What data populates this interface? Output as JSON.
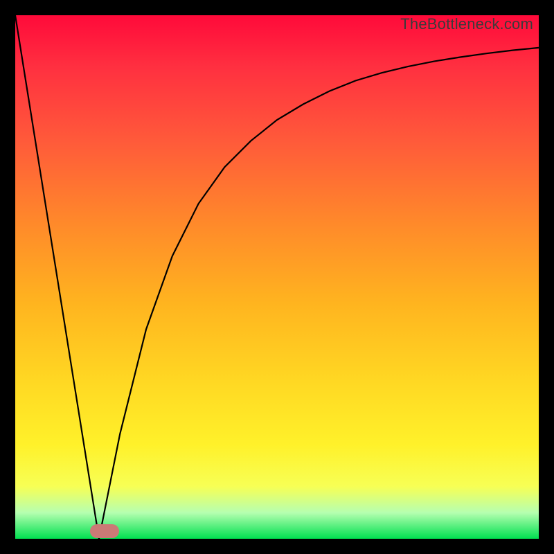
{
  "watermark": {
    "text": "TheBottleneck.com"
  },
  "colors": {
    "frame": "#000000",
    "curve": "#000000",
    "marker": "#cb7a76",
    "gradient_top": "#ff0a3a",
    "gradient_bottom": "#00e050"
  },
  "chart_data": {
    "type": "line",
    "title": "",
    "xlabel": "",
    "ylabel": "",
    "xlim": [
      0,
      100
    ],
    "ylim": [
      0,
      100
    ],
    "series": [
      {
        "name": "left-line",
        "x": [
          0,
          16
        ],
        "values": [
          100,
          0
        ]
      },
      {
        "name": "right-curve",
        "x": [
          16,
          20,
          25,
          30,
          35,
          40,
          45,
          50,
          55,
          60,
          65,
          70,
          75,
          80,
          85,
          90,
          95,
          100
        ],
        "values": [
          0,
          20,
          40,
          54,
          64,
          71,
          76,
          80,
          83,
          85.5,
          87.5,
          89,
          90.2,
          91.2,
          92,
          92.7,
          93.3,
          93.8
        ]
      }
    ],
    "marker": {
      "name": "optimal-point",
      "x": 17,
      "y": 1.5
    },
    "legend": false,
    "grid": false
  }
}
